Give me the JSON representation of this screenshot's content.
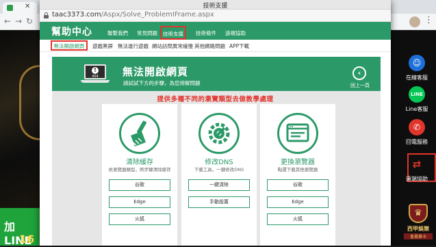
{
  "background": {
    "browser_url_text": "",
    "line_banner_line1": "加LINE",
    "line_banner_line2": "16",
    "side_menu": [
      {
        "label": "在線客服",
        "color": "#1e6fd9"
      },
      {
        "label": "Line客服",
        "color": "#06c755"
      },
      {
        "label": "回電服務",
        "color": "#e0352b"
      },
      {
        "label": "遠端協助",
        "color": "#e0352b"
      }
    ],
    "logo_title": "西甲娛樂",
    "logo_subtitle": "會員專卡"
  },
  "window": {
    "title": "技術支援",
    "url_host": "taac3373.com",
    "url_path": "/Aspx/Solve_ProblemIFrame.aspx"
  },
  "site": {
    "logo": "幫助中心",
    "nav": [
      "聯繫我們",
      "常見問題",
      "技術支援",
      "技術條件",
      "遠端協助"
    ],
    "nav_active_index": 2,
    "subnav": [
      "無法開啟網頁",
      "遊戲黑屏",
      "無法進行遊戲",
      "網站訪問異常緩慢",
      "其他網路問題",
      "APP下載"
    ],
    "subnav_active_index": 0
  },
  "banner": {
    "title": "無法開啟網頁",
    "subtitle": "請試試下方的步驟，為您排解問題",
    "back_label": "回上一頁",
    "laptop_code": "404",
    "accent_color": "#2c9a68"
  },
  "instruction": "提供多種不同的瀏覽類型去做教學處理",
  "cards": [
    {
      "title": "清除緩存",
      "desc": "依瀏覽器類型，照步驟清除緩存",
      "icon": "broom-icon",
      "buttons": [
        "谷歌",
        "Edge",
        "火狐"
      ]
    },
    {
      "title": "修改DNS",
      "desc": "下載工具，一鍵修改DNS",
      "icon": "gears-wrench-icon",
      "buttons": [
        "一鍵清除",
        "手動設置"
      ]
    },
    {
      "title": "更換瀏覽器",
      "desc": "點選下載其他瀏覽器",
      "icon": "browser-window-icon",
      "buttons": [
        "谷歌",
        "Edge",
        "火狐"
      ]
    }
  ]
}
